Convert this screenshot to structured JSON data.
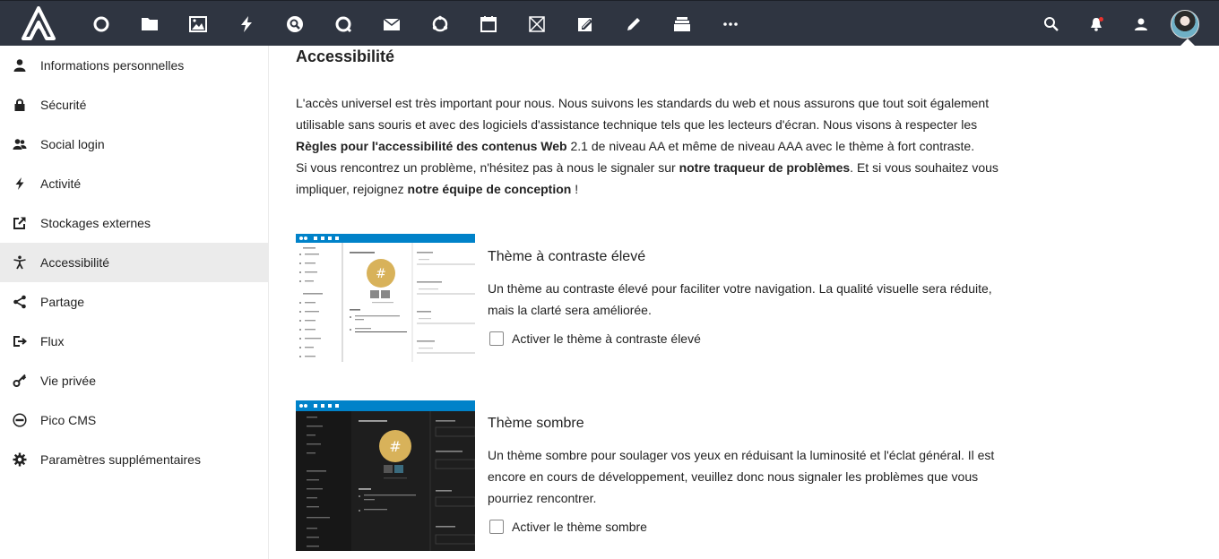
{
  "header": {
    "apps": [
      {
        "name": "dashboard-icon"
      },
      {
        "name": "files-icon"
      },
      {
        "name": "photos-icon"
      },
      {
        "name": "activity-icon"
      },
      {
        "name": "search-app-icon"
      },
      {
        "name": "talk-icon"
      },
      {
        "name": "mail-icon"
      },
      {
        "name": "sync-icon"
      },
      {
        "name": "calendar-icon"
      },
      {
        "name": "deck-icon"
      },
      {
        "name": "notes-icon"
      },
      {
        "name": "edit-icon"
      },
      {
        "name": "stack-icon"
      },
      {
        "name": "more-icon"
      }
    ],
    "right": [
      "search-icon",
      "notifications-icon",
      "contacts-icon",
      "avatar"
    ]
  },
  "sidebar": {
    "items": [
      {
        "label": "Informations personnelles",
        "icon": "user-icon"
      },
      {
        "label": "Sécurité",
        "icon": "lock-icon"
      },
      {
        "label": "Social login",
        "icon": "group-icon"
      },
      {
        "label": "Activité",
        "icon": "bolt-icon"
      },
      {
        "label": "Stockages externes",
        "icon": "external-icon"
      },
      {
        "label": "Accessibilité",
        "icon": "accessibility-icon",
        "active": true
      },
      {
        "label": "Partage",
        "icon": "share-icon"
      },
      {
        "label": "Flux",
        "icon": "flux-icon"
      },
      {
        "label": "Vie privée",
        "icon": "key-icon"
      },
      {
        "label": "Pico CMS",
        "icon": "pico-icon"
      },
      {
        "label": "Paramètres supplémentaires",
        "icon": "gear-icon"
      }
    ]
  },
  "main": {
    "title": "Accessibilité",
    "intro": {
      "p1_a": "L'accès universel est très important pour nous. Nous suivons les standards du web et nous assurons que tout soit également utilisable sans souris et avec des logiciels d'assistance technique tels que les lecteurs d'écran. Nous visons à respecter les ",
      "p1_link": "Règles pour l'accessibilité des contenus Web",
      "p1_b": " 2.1 de niveau AA et même de niveau AAA avec le thème à fort contraste.",
      "p2_a": "Si vous rencontrez un problème, n'hésitez pas à nous le signaler sur ",
      "p2_link1": "notre traqueur de problèmes",
      "p2_b": ". Et si vous souhaitez vous impliquer, rejoignez ",
      "p2_link2": "notre équipe de conception",
      "p2_c": " !"
    },
    "themes": [
      {
        "title": "Thème à contraste élevé",
        "description": "Un thème au contraste élevé pour faciliter votre navigation. La qualité visuelle sera réduite, mais la clarté sera améliorée.",
        "checkbox_label": "Activer le thème à contraste élevé",
        "checked": false
      },
      {
        "title": "Thème sombre",
        "description": "Un thème sombre pour soulager vos yeux en réduisant la luminosité et l'éclat général. Il est encore en cours de développement, veuillez donc nous signaler les problèmes que vous pourriez rencontrer.",
        "checkbox_label": "Activer le thème sombre",
        "checked": false
      }
    ]
  },
  "colors": {
    "header_bg": "#2f3541",
    "brand_blue": "#0082c9",
    "avatar_gold": "#d8b25a",
    "active_bg": "#ebebeb"
  }
}
